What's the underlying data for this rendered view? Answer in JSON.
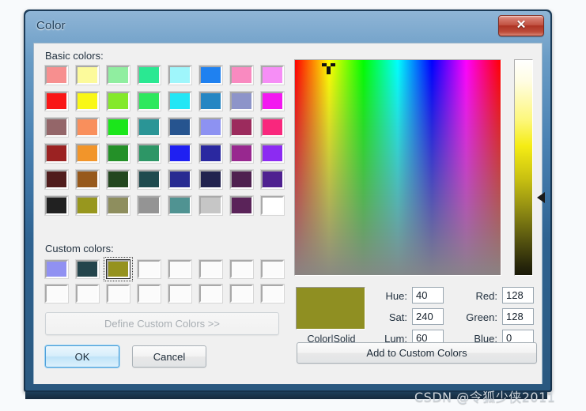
{
  "window": {
    "title": "Color",
    "close_label": "✕",
    "close_icon": "close-icon"
  },
  "basic_colors": {
    "label": "Basic colors:",
    "rows": 6,
    "cols": 8,
    "colors": [
      [
        "#f78f8f",
        "#fcfa9b",
        "#90eea0",
        "#2ae892",
        "#9ff6fb",
        "#1f81f0",
        "#f98ac0",
        "#f68ef6"
      ],
      [
        "#f91616",
        "#f9f716",
        "#84e92a",
        "#2ee85e",
        "#23e6f5",
        "#2586c3",
        "#8d94c9",
        "#f318f0"
      ],
      [
        "#946669",
        "#f98f5c",
        "#1be61b",
        "#2a9596",
        "#26548f",
        "#8d92f2",
        "#9c2b5d",
        "#f9277d"
      ],
      [
        "#9b2222",
        "#f2952a",
        "#249028",
        "#2d9666",
        "#1f20f2",
        "#2a28a0",
        "#98288f",
        "#8c2bf2"
      ],
      [
        "#501c1c",
        "#97591c",
        "#23471f",
        "#1f4b4f",
        "#282b91",
        "#22234f",
        "#4f2150",
        "#4f2190"
      ],
      [
        "#212121",
        "#98971e",
        "#8e8e5e",
        "#949494",
        "#509392",
        "#c6c6c6",
        "#5a2359",
        "#ffffff"
      ]
    ]
  },
  "custom_colors": {
    "label": "Custom colors:",
    "rows": 2,
    "cols": 8,
    "selected_index": 2,
    "colors": [
      "#9091f2",
      "#24454c",
      "#95921e",
      "#fbfbfb",
      "#fbfbfb",
      "#fbfbfb",
      "#fbfbfb",
      "#fbfbfb",
      "#fbfbfb",
      "#fbfbfb",
      "#fbfbfb",
      "#fbfbfb",
      "#fbfbfb",
      "#fbfbfb",
      "#fbfbfb",
      "#fbfbfb"
    ]
  },
  "buttons": {
    "define_custom": "Define Custom Colors >>",
    "define_custom_enabled": false,
    "ok": "OK",
    "cancel": "Cancel",
    "add_to_custom": "Add to Custom Colors"
  },
  "preview": {
    "caption": "Color|Solid",
    "color": "#8f8f22"
  },
  "fields": {
    "hue": {
      "label": "Hue:",
      "value": "40"
    },
    "sat": {
      "label": "Sat:",
      "value": "240"
    },
    "lum": {
      "label": "Lum:",
      "value": "60"
    },
    "red": {
      "label": "Red:",
      "value": "128"
    },
    "green": {
      "label": "Green:",
      "value": "128"
    },
    "blue": {
      "label": "Blue:",
      "value": "0"
    }
  },
  "spectrum": {
    "cursor_x_pct": 16,
    "cursor_y_pct": 1
  },
  "luminance": {
    "arrow_pos_pct": 64
  },
  "watermark": {
    "text": "CSDN @令狐少侠2011"
  }
}
